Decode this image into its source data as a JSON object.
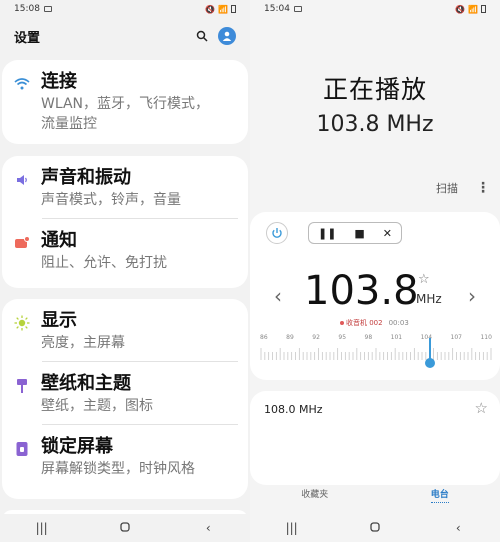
{
  "left": {
    "status": {
      "time": "15:08"
    },
    "header": {
      "title": "设置"
    },
    "cards": [
      {
        "items": [
          {
            "title": "连接",
            "sub": "WLAN，蓝牙，飞行模式，",
            "sub2": "流量监控"
          }
        ]
      },
      {
        "items": [
          {
            "title": "声音和振动",
            "sub": "声音模式，铃声，音量"
          },
          {
            "title": "通知",
            "sub": "阻止、允许、免打扰"
          }
        ]
      },
      {
        "items": [
          {
            "title": "显示",
            "sub": "亮度，主屏幕"
          },
          {
            "title": "壁纸和主题",
            "sub": "壁纸，主题，图标"
          },
          {
            "title": "锁定屏幕",
            "sub": "屏幕解锁类型，时钟风格"
          }
        ]
      }
    ],
    "icon_colors": {
      "wifi": "#3a8fd6",
      "sound": "#7a6ee0",
      "notify": "#ee6a5c",
      "display": "#b6d33c",
      "wallpaper": "#8a63d2",
      "lock": "#8a63d2"
    }
  },
  "right": {
    "status": {
      "time": "15:04"
    },
    "now_playing": "正在播放",
    "frequency_display": "103.8 MHz",
    "scan_label": "扫描",
    "tuner": {
      "frequency": "103.8",
      "unit": "MHz",
      "recording_label": "收音机 002",
      "recording_time": "00:03",
      "scale": [
        "86",
        "89",
        "92",
        "95",
        "98",
        "101",
        "104",
        "107",
        "110"
      ]
    },
    "station": {
      "frequency": "108.0 MHz"
    },
    "tabs": {
      "favorites": "收藏夹",
      "radio": "电台"
    },
    "accent": "#3a9ad9"
  }
}
